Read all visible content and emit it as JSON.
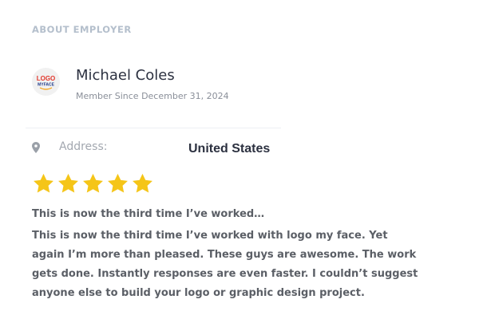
{
  "section": {
    "title": "ABOUT EMPLOYER"
  },
  "employer": {
    "logo": {
      "line1": "LOGO",
      "line2": "MYFACE",
      "colors": {
        "logo_text": "#e2362b",
        "tagline": "#1e3a8a",
        "swoosh": "#f59e0b"
      }
    },
    "name": "Michael Coles",
    "member_since": "Member Since December 31, 2024"
  },
  "details": {
    "address_icon": "map-pin-icon",
    "address_label": "Address:",
    "address_value": "United States"
  },
  "review": {
    "rating": 5,
    "max_rating": 5,
    "star_icon": "star-icon",
    "star_color": "#f5c518",
    "title": "This is now the third time I’ve worked…",
    "body": "This is now the third time I’ve worked with logo my face. Yet again I’m more than pleased. These guys are awesome. The work gets done. Instantly responses are even faster. I couldn’t suggest anyone else to build your logo or graphic design project."
  }
}
